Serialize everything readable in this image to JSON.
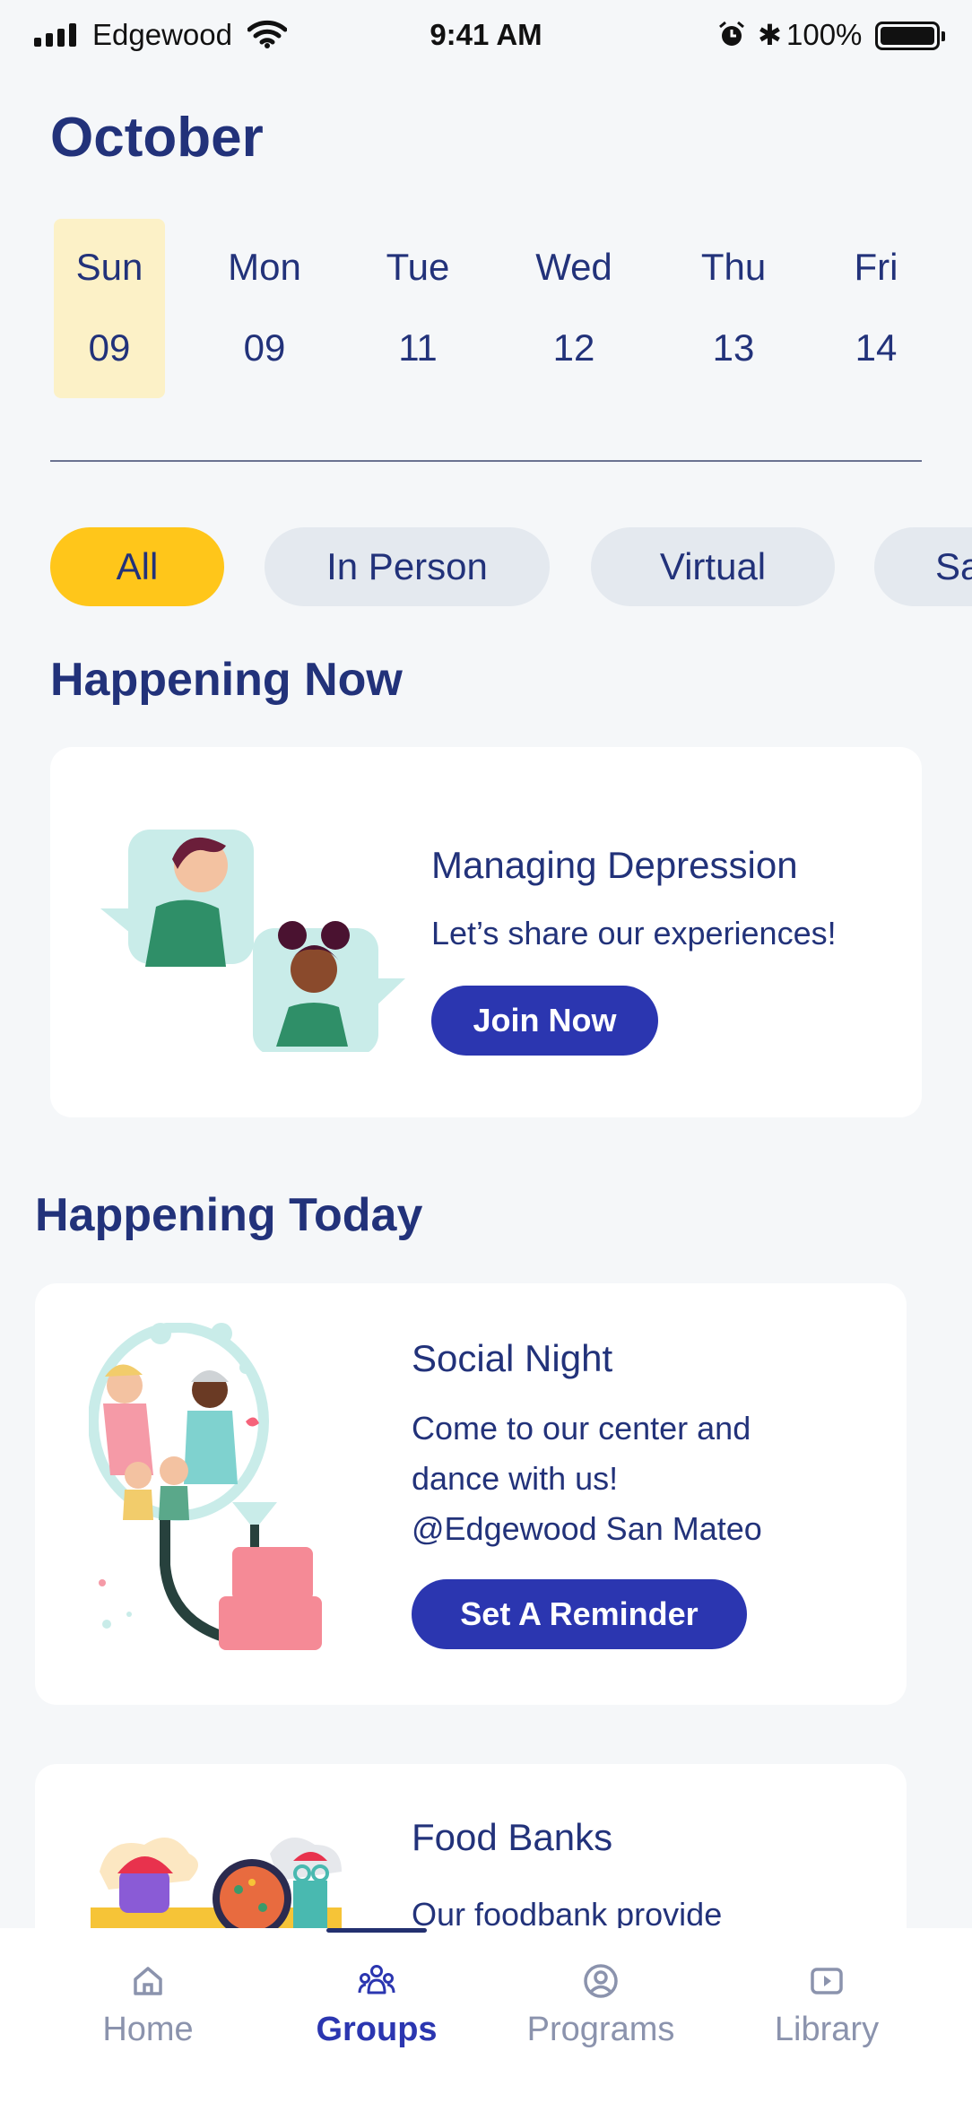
{
  "status_bar": {
    "carrier": "Edgewood",
    "time": "9:41 AM",
    "battery": "100%"
  },
  "calendar": {
    "month": "October",
    "days": [
      {
        "name": "Sun",
        "num": "09",
        "selected": true
      },
      {
        "name": "Mon",
        "num": "09"
      },
      {
        "name": "Tue",
        "num": "11"
      },
      {
        "name": "Wed",
        "num": "12"
      },
      {
        "name": "Thu",
        "num": "13"
      },
      {
        "name": "Fri",
        "num": "14"
      }
    ]
  },
  "filters": [
    {
      "label": "All",
      "active": true
    },
    {
      "label": "In Person"
    },
    {
      "label": "Virtual"
    },
    {
      "label": "Sa"
    }
  ],
  "happening_now": {
    "title": "Happening Now",
    "card": {
      "title": "Managing Depression",
      "description": "Let’s share our experiences!",
      "button": "Join Now"
    }
  },
  "happening_today": {
    "title": "Happening Today",
    "cards": [
      {
        "title": "Social Night",
        "description_lines": [
          "Come to our center and",
          "dance with us!",
          "@Edgewood San Mateo"
        ],
        "button": "Set A Reminder"
      },
      {
        "title": "Food Banks",
        "description_lines": [
          "Our foodbank provide"
        ]
      }
    ]
  },
  "bottom_nav": [
    {
      "label": "Home",
      "icon": "home-icon"
    },
    {
      "label": "Groups",
      "icon": "groups-icon",
      "active": true
    },
    {
      "label": "Programs",
      "icon": "programs-icon"
    },
    {
      "label": "Library",
      "icon": "library-icon"
    }
  ],
  "colors": {
    "primary": "#2b36b0",
    "heading": "#22327a",
    "accent_yellow": "#ffc61a",
    "selected_day_bg": "#fcf1c7",
    "chip_bg": "#e4e9ef",
    "background": "#f5f7f9"
  }
}
